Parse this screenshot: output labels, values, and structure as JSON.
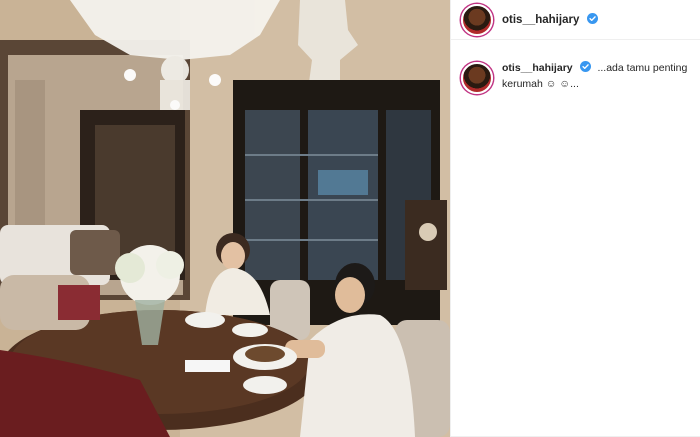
{
  "post": {
    "username": "otis__hahijary",
    "verified": true,
    "caption": "...ada tamu penting kerumah",
    "caption_emoji": "☺ ☺..."
  },
  "colors": {
    "verified_badge": "#3897f0",
    "story_ring": "#c13584",
    "panel_bg": "#ffffff"
  },
  "icons": {
    "verified": "verified-check-icon"
  }
}
